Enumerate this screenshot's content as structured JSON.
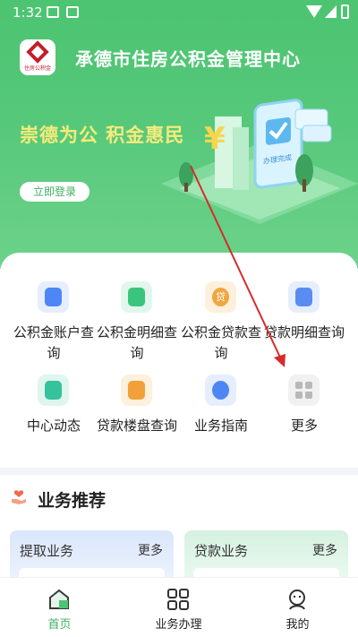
{
  "status_bar": {
    "time": "1:32"
  },
  "header": {
    "title": "承德市住房公积金管理中心",
    "logo_text": "住房公积金"
  },
  "banner": {
    "slogan": "崇德为公 积金惠民",
    "login_label": "立即登录",
    "illustration_symbol": "¥",
    "phone_caption": "办理完成"
  },
  "services": [
    {
      "label": "公积金账户查询",
      "icon": "account-icon",
      "color": "#4e86f5"
    },
    {
      "label": "公积金明细查询",
      "icon": "detail-icon",
      "color": "#3bc47e"
    },
    {
      "label": "公积金贷款查询",
      "icon": "loan-icon",
      "color": "#f0a640",
      "glyph": "贷"
    },
    {
      "label": "贷款明细查询",
      "icon": "loan-detail-icon",
      "color": "#5a8cf2"
    },
    {
      "label": "中心动态",
      "icon": "news-icon",
      "color": "#36c29b"
    },
    {
      "label": "贷款楼盘查询",
      "icon": "building-icon",
      "color": "#f2a03a"
    },
    {
      "label": "业务指南",
      "icon": "guide-icon",
      "color": "#4f86f5"
    },
    {
      "label": "更多",
      "icon": "more-grid-icon",
      "color": "#b8b8b8"
    }
  ],
  "recommend": {
    "title": "业务推荐",
    "cards": [
      {
        "name": "提取业务",
        "more": "更多",
        "bg": "#dfe9fb"
      },
      {
        "name": "贷款业务",
        "more": "更多",
        "bg": "#ddf3e6"
      }
    ]
  },
  "tabs": [
    {
      "label": "首页",
      "active": true
    },
    {
      "label": "业务办理",
      "active": false
    },
    {
      "label": "我的",
      "active": false
    }
  ],
  "colors": {
    "primary": "#4cc471",
    "active_tab": "#3fae63",
    "annotation": "#d62b2b"
  }
}
